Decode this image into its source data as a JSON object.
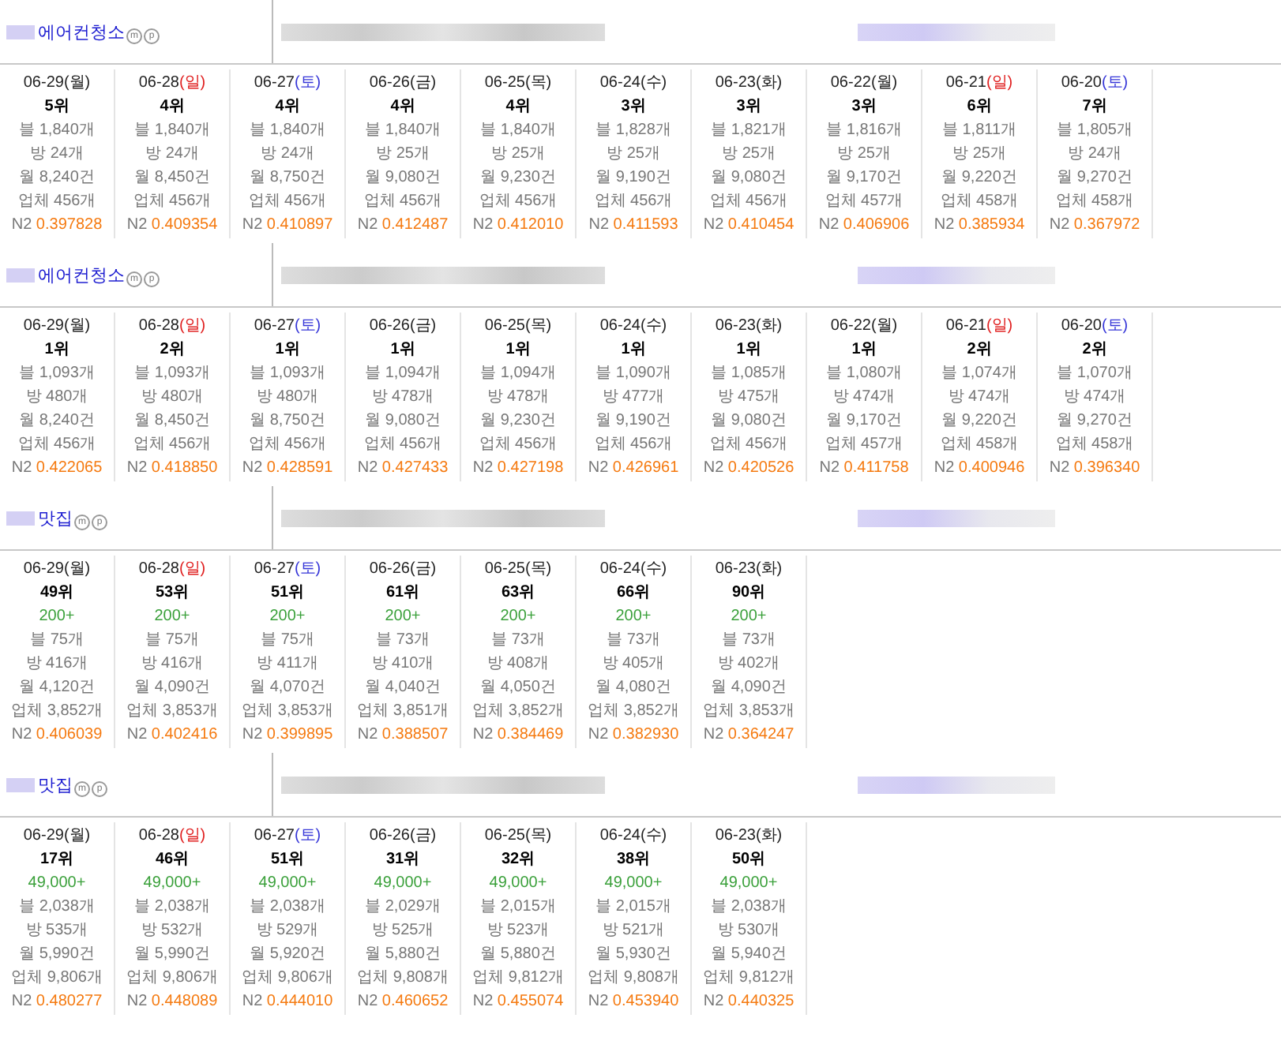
{
  "sections": [
    {
      "keyword": "에어컨청소",
      "badges": [
        "m",
        "p"
      ],
      "days": [
        {
          "date": "06-29",
          "weekday": "(월)",
          "color": "#222222",
          "rank": "5위",
          "blog": "블 1,840개",
          "cafe": "방 24개",
          "monthly": "월 8,240건",
          "company": "업체 456개",
          "score_label": "N2",
          "score": "0.397828"
        },
        {
          "date": "06-28",
          "weekday": "(일)",
          "color": "#e02020",
          "rank": "4위",
          "blog": "블 1,840개",
          "cafe": "방 24개",
          "monthly": "월 8,450건",
          "company": "업체 456개",
          "score_label": "N2",
          "score": "0.409354"
        },
        {
          "date": "06-27",
          "weekday": "(토)",
          "color": "#3636d8",
          "rank": "4위",
          "blog": "블 1,840개",
          "cafe": "방 24개",
          "monthly": "월 8,750건",
          "company": "업체 456개",
          "score_label": "N2",
          "score": "0.410897"
        },
        {
          "date": "06-26",
          "weekday": "(금)",
          "color": "#222222",
          "rank": "4위",
          "blog": "블 1,840개",
          "cafe": "방 25개",
          "monthly": "월 9,080건",
          "company": "업체 456개",
          "score_label": "N2",
          "score": "0.412487"
        },
        {
          "date": "06-25",
          "weekday": "(목)",
          "color": "#222222",
          "rank": "4위",
          "blog": "블 1,840개",
          "cafe": "방 25개",
          "monthly": "월 9,230건",
          "company": "업체 456개",
          "score_label": "N2",
          "score": "0.412010"
        },
        {
          "date": "06-24",
          "weekday": "(수)",
          "color": "#222222",
          "rank": "3위",
          "blog": "블 1,828개",
          "cafe": "방 25개",
          "monthly": "월 9,190건",
          "company": "업체 456개",
          "score_label": "N2",
          "score": "0.411593"
        },
        {
          "date": "06-23",
          "weekday": "(화)",
          "color": "#222222",
          "rank": "3위",
          "blog": "블 1,821개",
          "cafe": "방 25개",
          "monthly": "월 9,080건",
          "company": "업체 456개",
          "score_label": "N2",
          "score": "0.410454"
        },
        {
          "date": "06-22",
          "weekday": "(월)",
          "color": "#222222",
          "rank": "3위",
          "blog": "블 1,816개",
          "cafe": "방 25개",
          "monthly": "월 9,170건",
          "company": "업체 457개",
          "score_label": "N2",
          "score": "0.406906"
        },
        {
          "date": "06-21",
          "weekday": "(일)",
          "color": "#e02020",
          "rank": "6위",
          "blog": "블 1,811개",
          "cafe": "방 25개",
          "monthly": "월 9,220건",
          "company": "업체 458개",
          "score_label": "N2",
          "score": "0.385934"
        },
        {
          "date": "06-20",
          "weekday": "(토)",
          "color": "#3636d8",
          "rank": "7위",
          "blog": "블 1,805개",
          "cafe": "방 24개",
          "monthly": "월 9,270건",
          "company": "업체 458개",
          "score_label": "N2",
          "score": "0.367972"
        }
      ]
    },
    {
      "keyword": "에어컨청소",
      "badges": [
        "m",
        "p"
      ],
      "days": [
        {
          "date": "06-29",
          "weekday": "(월)",
          "color": "#222222",
          "rank": "1위",
          "blog": "블 1,093개",
          "cafe": "방 480개",
          "monthly": "월 8,240건",
          "company": "업체 456개",
          "score_label": "N2",
          "score": "0.422065"
        },
        {
          "date": "06-28",
          "weekday": "(일)",
          "color": "#e02020",
          "rank": "2위",
          "blog": "블 1,093개",
          "cafe": "방 480개",
          "monthly": "월 8,450건",
          "company": "업체 456개",
          "score_label": "N2",
          "score": "0.418850"
        },
        {
          "date": "06-27",
          "weekday": "(토)",
          "color": "#3636d8",
          "rank": "1위",
          "blog": "블 1,093개",
          "cafe": "방 480개",
          "monthly": "월 8,750건",
          "company": "업체 456개",
          "score_label": "N2",
          "score": "0.428591"
        },
        {
          "date": "06-26",
          "weekday": "(금)",
          "color": "#222222",
          "rank": "1위",
          "blog": "블 1,094개",
          "cafe": "방 478개",
          "monthly": "월 9,080건",
          "company": "업체 456개",
          "score_label": "N2",
          "score": "0.427433"
        },
        {
          "date": "06-25",
          "weekday": "(목)",
          "color": "#222222",
          "rank": "1위",
          "blog": "블 1,094개",
          "cafe": "방 478개",
          "monthly": "월 9,230건",
          "company": "업체 456개",
          "score_label": "N2",
          "score": "0.427198"
        },
        {
          "date": "06-24",
          "weekday": "(수)",
          "color": "#222222",
          "rank": "1위",
          "blog": "블 1,090개",
          "cafe": "방 477개",
          "monthly": "월 9,190건",
          "company": "업체 456개",
          "score_label": "N2",
          "score": "0.426961"
        },
        {
          "date": "06-23",
          "weekday": "(화)",
          "color": "#222222",
          "rank": "1위",
          "blog": "블 1,085개",
          "cafe": "방 475개",
          "monthly": "월 9,080건",
          "company": "업체 456개",
          "score_label": "N2",
          "score": "0.420526"
        },
        {
          "date": "06-22",
          "weekday": "(월)",
          "color": "#222222",
          "rank": "1위",
          "blog": "블 1,080개",
          "cafe": "방 474개",
          "monthly": "월 9,170건",
          "company": "업체 457개",
          "score_label": "N2",
          "score": "0.411758"
        },
        {
          "date": "06-21",
          "weekday": "(일)",
          "color": "#e02020",
          "rank": "2위",
          "blog": "블 1,074개",
          "cafe": "방 474개",
          "monthly": "월 9,220건",
          "company": "업체 458개",
          "score_label": "N2",
          "score": "0.400946"
        },
        {
          "date": "06-20",
          "weekday": "(토)",
          "color": "#3636d8",
          "rank": "2위",
          "blog": "블 1,070개",
          "cafe": "방 474개",
          "monthly": "월 9,270건",
          "company": "업체 458개",
          "score_label": "N2",
          "score": "0.396340"
        }
      ]
    },
    {
      "keyword": "맛집",
      "badges": [
        "m",
        "p"
      ],
      "days": [
        {
          "date": "06-29",
          "weekday": "(월)",
          "color": "#222222",
          "rank": "49위",
          "volume": "200+",
          "blog": "블 75개",
          "cafe": "방 416개",
          "monthly": "월 4,120건",
          "company": "업체 3,852개",
          "score_label": "N2",
          "score": "0.406039"
        },
        {
          "date": "06-28",
          "weekday": "(일)",
          "color": "#e02020",
          "rank": "53위",
          "volume": "200+",
          "blog": "블 75개",
          "cafe": "방 416개",
          "monthly": "월 4,090건",
          "company": "업체 3,853개",
          "score_label": "N2",
          "score": "0.402416"
        },
        {
          "date": "06-27",
          "weekday": "(토)",
          "color": "#3636d8",
          "rank": "51위",
          "volume": "200+",
          "blog": "블 75개",
          "cafe": "방 411개",
          "monthly": "월 4,070건",
          "company": "업체 3,853개",
          "score_label": "N2",
          "score": "0.399895"
        },
        {
          "date": "06-26",
          "weekday": "(금)",
          "color": "#222222",
          "rank": "61위",
          "volume": "200+",
          "blog": "블 73개",
          "cafe": "방 410개",
          "monthly": "월 4,040건",
          "company": "업체 3,851개",
          "score_label": "N2",
          "score": "0.388507"
        },
        {
          "date": "06-25",
          "weekday": "(목)",
          "color": "#222222",
          "rank": "63위",
          "volume": "200+",
          "blog": "블 73개",
          "cafe": "방 408개",
          "monthly": "월 4,050건",
          "company": "업체 3,852개",
          "score_label": "N2",
          "score": "0.384469"
        },
        {
          "date": "06-24",
          "weekday": "(수)",
          "color": "#222222",
          "rank": "66위",
          "volume": "200+",
          "blog": "블 73개",
          "cafe": "방 405개",
          "monthly": "월 4,080건",
          "company": "업체 3,852개",
          "score_label": "N2",
          "score": "0.382930"
        },
        {
          "date": "06-23",
          "weekday": "(화)",
          "color": "#222222",
          "rank": "90위",
          "volume": "200+",
          "blog": "블 73개",
          "cafe": "방 402개",
          "monthly": "월 4,090건",
          "company": "업체 3,853개",
          "score_label": "N2",
          "score": "0.364247"
        }
      ]
    },
    {
      "keyword": "맛집",
      "badges": [
        "m",
        "p"
      ],
      "days": [
        {
          "date": "06-29",
          "weekday": "(월)",
          "color": "#222222",
          "rank": "17위",
          "volume": "49,000+",
          "blog": "블 2,038개",
          "cafe": "방 535개",
          "monthly": "월 5,990건",
          "company": "업체 9,806개",
          "score_label": "N2",
          "score": "0.480277"
        },
        {
          "date": "06-28",
          "weekday": "(일)",
          "color": "#e02020",
          "rank": "46위",
          "volume": "49,000+",
          "blog": "블 2,038개",
          "cafe": "방 532개",
          "monthly": "월 5,990건",
          "company": "업체 9,806개",
          "score_label": "N2",
          "score": "0.448089"
        },
        {
          "date": "06-27",
          "weekday": "(토)",
          "color": "#3636d8",
          "rank": "51위",
          "volume": "49,000+",
          "blog": "블 2,038개",
          "cafe": "방 529개",
          "monthly": "월 5,920건",
          "company": "업체 9,806개",
          "score_label": "N2",
          "score": "0.444010"
        },
        {
          "date": "06-26",
          "weekday": "(금)",
          "color": "#222222",
          "rank": "31위",
          "volume": "49,000+",
          "blog": "블 2,029개",
          "cafe": "방 525개",
          "monthly": "월 5,880건",
          "company": "업체 9,808개",
          "score_label": "N2",
          "score": "0.460652"
        },
        {
          "date": "06-25",
          "weekday": "(목)",
          "color": "#222222",
          "rank": "32위",
          "volume": "49,000+",
          "blog": "블 2,015개",
          "cafe": "방 523개",
          "monthly": "월 5,880건",
          "company": "업체 9,812개",
          "score_label": "N2",
          "score": "0.455074"
        },
        {
          "date": "06-24",
          "weekday": "(수)",
          "color": "#222222",
          "rank": "38위",
          "volume": "49,000+",
          "blog": "블 2,015개",
          "cafe": "방 521개",
          "monthly": "월 5,930건",
          "company": "업체 9,808개",
          "score_label": "N2",
          "score": "0.453940"
        },
        {
          "date": "06-23",
          "weekday": "(화)",
          "color": "#222222",
          "rank": "50위",
          "volume": "49,000+",
          "blog": "블 2,038개",
          "cafe": "방 530개",
          "monthly": "월 5,940건",
          "company": "업체 9,812개",
          "score_label": "N2",
          "score": "0.440325"
        }
      ]
    }
  ]
}
